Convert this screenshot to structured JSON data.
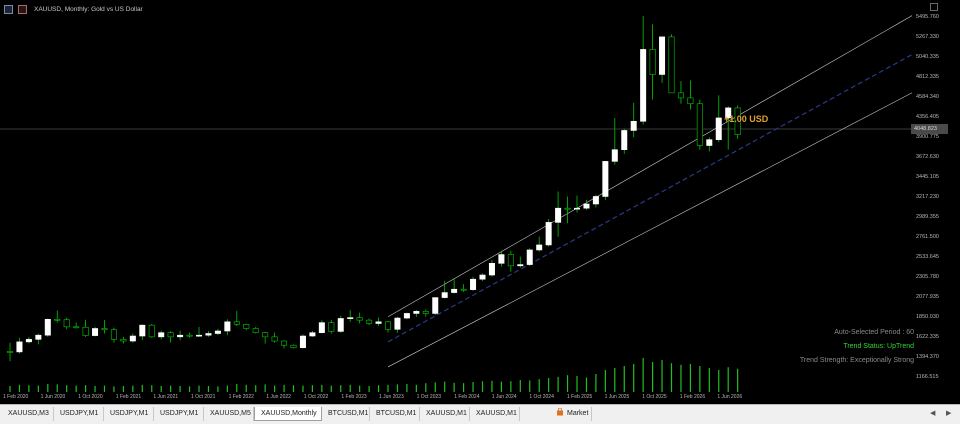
{
  "title": "XAUUSD, Monthly:  Gold vs US Dollar",
  "price_axis": {
    "labels": [
      "5495.760",
      "5267.330",
      "5040.335",
      "4812.335",
      "4584.340",
      "4356.405",
      "3900.775",
      "3672.630",
      "3445.105",
      "3217.230",
      "2989.355",
      "2761.500",
      "2533.645",
      "2305.780",
      "2077.935",
      "1850.030",
      "1622.335",
      "1394.370",
      "1166.515"
    ],
    "current_price": "4048.823"
  },
  "time_axis": {
    "labels": [
      "1 Feb 2020",
      "1 Jun 2020",
      "1 Oct 2020",
      "1 Feb 2021",
      "1 Jun 2021",
      "1 Oct 2021",
      "1 Feb 2022",
      "1 Jun 2022",
      "1 Oct 2022",
      "1 Feb 2023",
      "1 Jun 2023",
      "1 Oct 2023",
      "1 Feb 2024",
      "1 Jun 2024",
      "1 Oct 2024",
      "1 Feb 2025",
      "1 Jun 2025",
      "1 Oct 2025",
      "1 Feb 2026",
      "1 Jun 2026"
    ]
  },
  "info": {
    "period": "Auto-Selected Period : 60",
    "status": "Trend Status: UpTrend",
    "strength": "Trend Strength: Exceptionally Strong"
  },
  "profit_label": "+1.00 USD",
  "colors": {
    "bull": "#ffffff",
    "bear": "#000000",
    "wick": "#00c800",
    "volume": "#20c020",
    "channel": "#c8c8c8",
    "midline": "#2a3a8a",
    "profit": "#e0a030",
    "status": "#35d435"
  },
  "tabs": [
    {
      "label": "XAUUSD,M3",
      "active": false,
      "icon": null
    },
    {
      "label": "USDJPY,M1",
      "active": false,
      "icon": null
    },
    {
      "label": "USDJPY,M1",
      "active": false,
      "icon": null
    },
    {
      "label": "USDJPY,M1",
      "active": false,
      "icon": null
    },
    {
      "label": "XAUUSD,M5",
      "active": false,
      "icon": null
    },
    {
      "label": "XAUUSD,Monthly",
      "active": true,
      "icon": null
    },
    {
      "label": "BTCUSD,M1",
      "active": false,
      "icon": null
    },
    {
      "label": "BTCUSD,M1",
      "active": false,
      "icon": null
    },
    {
      "label": "XAUUSD,M1",
      "active": false,
      "icon": null
    },
    {
      "label": "XAUUSD,M1",
      "active": false,
      "icon": null
    },
    {
      "label": "Market",
      "active": false,
      "icon": "market-bag-icon"
    }
  ],
  "chart_data": {
    "type": "candlestick",
    "symbol": "XAUUSD",
    "timeframe": "Monthly",
    "ylim": [
      1100,
      5600
    ],
    "candles": [
      {
        "o": 1585,
        "h": 1690,
        "l": 1470,
        "c": 1580
      },
      {
        "o": 1580,
        "h": 1750,
        "l": 1560,
        "c": 1700
      },
      {
        "o": 1700,
        "h": 1760,
        "l": 1680,
        "c": 1730
      },
      {
        "o": 1730,
        "h": 1800,
        "l": 1670,
        "c": 1780
      },
      {
        "o": 1780,
        "h": 1980,
        "l": 1760,
        "c": 1970
      },
      {
        "o": 1970,
        "h": 2075,
        "l": 1930,
        "c": 1965
      },
      {
        "o": 1965,
        "h": 1990,
        "l": 1850,
        "c": 1880
      },
      {
        "o": 1880,
        "h": 1930,
        "l": 1860,
        "c": 1875
      },
      {
        "o": 1875,
        "h": 1965,
        "l": 1760,
        "c": 1775
      },
      {
        "o": 1775,
        "h": 1880,
        "l": 1765,
        "c": 1860
      },
      {
        "o": 1860,
        "h": 1960,
        "l": 1800,
        "c": 1845
      },
      {
        "o": 1845,
        "h": 1870,
        "l": 1690,
        "c": 1730
      },
      {
        "o": 1730,
        "h": 1760,
        "l": 1680,
        "c": 1710
      },
      {
        "o": 1710,
        "h": 1800,
        "l": 1690,
        "c": 1770
      },
      {
        "o": 1770,
        "h": 1910,
        "l": 1720,
        "c": 1900
      },
      {
        "o": 1900,
        "h": 1915,
        "l": 1750,
        "c": 1760
      },
      {
        "o": 1760,
        "h": 1835,
        "l": 1730,
        "c": 1810
      },
      {
        "o": 1810,
        "h": 1830,
        "l": 1690,
        "c": 1760
      },
      {
        "o": 1760,
        "h": 1835,
        "l": 1720,
        "c": 1780
      },
      {
        "o": 1780,
        "h": 1810,
        "l": 1750,
        "c": 1775
      },
      {
        "o": 1775,
        "h": 1880,
        "l": 1760,
        "c": 1780
      },
      {
        "o": 1780,
        "h": 1830,
        "l": 1760,
        "c": 1800
      },
      {
        "o": 1800,
        "h": 1855,
        "l": 1780,
        "c": 1830
      },
      {
        "o": 1830,
        "h": 1970,
        "l": 1780,
        "c": 1940
      },
      {
        "o": 1940,
        "h": 2070,
        "l": 1890,
        "c": 1910
      },
      {
        "o": 1910,
        "h": 1920,
        "l": 1840,
        "c": 1860
      },
      {
        "o": 1860,
        "h": 1880,
        "l": 1800,
        "c": 1810
      },
      {
        "o": 1810,
        "h": 1820,
        "l": 1680,
        "c": 1760
      },
      {
        "o": 1760,
        "h": 1810,
        "l": 1690,
        "c": 1710
      },
      {
        "o": 1710,
        "h": 1720,
        "l": 1620,
        "c": 1660
      },
      {
        "o": 1660,
        "h": 1670,
        "l": 1620,
        "c": 1630
      },
      {
        "o": 1630,
        "h": 1790,
        "l": 1620,
        "c": 1770
      },
      {
        "o": 1770,
        "h": 1830,
        "l": 1760,
        "c": 1810
      },
      {
        "o": 1810,
        "h": 1960,
        "l": 1800,
        "c": 1930
      },
      {
        "o": 1930,
        "h": 1960,
        "l": 1800,
        "c": 1825
      },
      {
        "o": 1825,
        "h": 2010,
        "l": 1810,
        "c": 1980
      },
      {
        "o": 1980,
        "h": 2080,
        "l": 1940,
        "c": 1990
      },
      {
        "o": 1990,
        "h": 2050,
        "l": 1920,
        "c": 1960
      },
      {
        "o": 1960,
        "h": 1980,
        "l": 1900,
        "c": 1920
      },
      {
        "o": 1920,
        "h": 1990,
        "l": 1890,
        "c": 1940
      },
      {
        "o": 1940,
        "h": 1950,
        "l": 1810,
        "c": 1850
      },
      {
        "o": 1850,
        "h": 2000,
        "l": 1810,
        "c": 1985
      },
      {
        "o": 1985,
        "h": 2050,
        "l": 1970,
        "c": 2040
      },
      {
        "o": 2040,
        "h": 2080,
        "l": 2000,
        "c": 2065
      },
      {
        "o": 2065,
        "h": 2090,
        "l": 2000,
        "c": 2040
      },
      {
        "o": 2040,
        "h": 2200,
        "l": 2020,
        "c": 2230
      },
      {
        "o": 2230,
        "h": 2430,
        "l": 2220,
        "c": 2290
      },
      {
        "o": 2290,
        "h": 2450,
        "l": 2280,
        "c": 2330
      },
      {
        "o": 2330,
        "h": 2390,
        "l": 2300,
        "c": 2325
      },
      {
        "o": 2325,
        "h": 2480,
        "l": 2310,
        "c": 2450
      },
      {
        "o": 2450,
        "h": 2520,
        "l": 2430,
        "c": 2500
      },
      {
        "o": 2500,
        "h": 2680,
        "l": 2480,
        "c": 2640
      },
      {
        "o": 2640,
        "h": 2790,
        "l": 2600,
        "c": 2745
      },
      {
        "o": 2745,
        "h": 2790,
        "l": 2540,
        "c": 2610
      },
      {
        "o": 2610,
        "h": 2720,
        "l": 2590,
        "c": 2625
      },
      {
        "o": 2625,
        "h": 2820,
        "l": 2610,
        "c": 2800
      },
      {
        "o": 2800,
        "h": 2960,
        "l": 2780,
        "c": 2860
      },
      {
        "o": 2860,
        "h": 3170,
        "l": 2840,
        "c": 3130
      },
      {
        "o": 3130,
        "h": 3500,
        "l": 2960,
        "c": 3300
      },
      {
        "o": 3300,
        "h": 3440,
        "l": 3120,
        "c": 3290
      },
      {
        "o": 3290,
        "h": 3450,
        "l": 3250,
        "c": 3300
      },
      {
        "o": 3300,
        "h": 3400,
        "l": 3280,
        "c": 3350
      },
      {
        "o": 3350,
        "h": 3460,
        "l": 3310,
        "c": 3440
      },
      {
        "o": 3440,
        "h": 3860,
        "l": 3400,
        "c": 3860
      },
      {
        "o": 3860,
        "h": 4380,
        "l": 3820,
        "c": 4000
      },
      {
        "o": 4000,
        "h": 4250,
        "l": 3950,
        "c": 4230
      },
      {
        "o": 4230,
        "h": 4560,
        "l": 4150,
        "c": 4340
      },
      {
        "o": 4340,
        "h": 5600,
        "l": 4300,
        "c": 5200
      },
      {
        "o": 5200,
        "h": 5500,
        "l": 4600,
        "c": 4900
      },
      {
        "o": 4900,
        "h": 5350,
        "l": 4800,
        "c": 5350
      },
      {
        "o": 5350,
        "h": 5380,
        "l": 4800,
        "c": 4680
      },
      {
        "o": 4680,
        "h": 4820,
        "l": 4550,
        "c": 4620
      },
      {
        "o": 4620,
        "h": 4830,
        "l": 4480,
        "c": 4550
      },
      {
        "o": 4550,
        "h": 4600,
        "l": 4000,
        "c": 4050
      },
      {
        "o": 4050,
        "h": 4150,
        "l": 3980,
        "c": 4120
      },
      {
        "o": 4120,
        "h": 4650,
        "l": 4090,
        "c": 4380
      },
      {
        "o": 4380,
        "h": 4520,
        "l": 4000,
        "c": 4500
      },
      {
        "o": 4500,
        "h": 4530,
        "l": 4130,
        "c": 4180
      }
    ],
    "volumes": [
      0.15,
      0.18,
      0.17,
      0.16,
      0.2,
      0.19,
      0.17,
      0.16,
      0.17,
      0.15,
      0.16,
      0.14,
      0.15,
      0.16,
      0.18,
      0.17,
      0.15,
      0.16,
      0.15,
      0.14,
      0.16,
      0.15,
      0.14,
      0.16,
      0.2,
      0.18,
      0.17,
      0.19,
      0.16,
      0.18,
      0.17,
      0.16,
      0.17,
      0.18,
      0.16,
      0.17,
      0.18,
      0.16,
      0.15,
      0.17,
      0.18,
      0.19,
      0.2,
      0.18,
      0.22,
      0.24,
      0.26,
      0.23,
      0.22,
      0.25,
      0.27,
      0.28,
      0.26,
      0.27,
      0.3,
      0.29,
      0.32,
      0.35,
      0.38,
      0.42,
      0.4,
      0.36,
      0.45,
      0.55,
      0.6,
      0.65,
      0.7,
      0.85,
      0.75,
      0.8,
      0.72,
      0.68,
      0.7,
      0.65,
      0.6,
      0.55,
      0.62,
      0.58
    ],
    "channel_upper": [
      {
        "x": 40,
        "y": 2000
      },
      {
        "x": 100,
        "y": 5900
      }
    ],
    "channel_lower": [
      {
        "x": 40,
        "y": 1400
      },
      {
        "x": 100,
        "y": 4950
      }
    ],
    "midline": [
      {
        "x": 40,
        "y": 1700
      },
      {
        "x": 100,
        "y": 5420
      }
    ]
  }
}
